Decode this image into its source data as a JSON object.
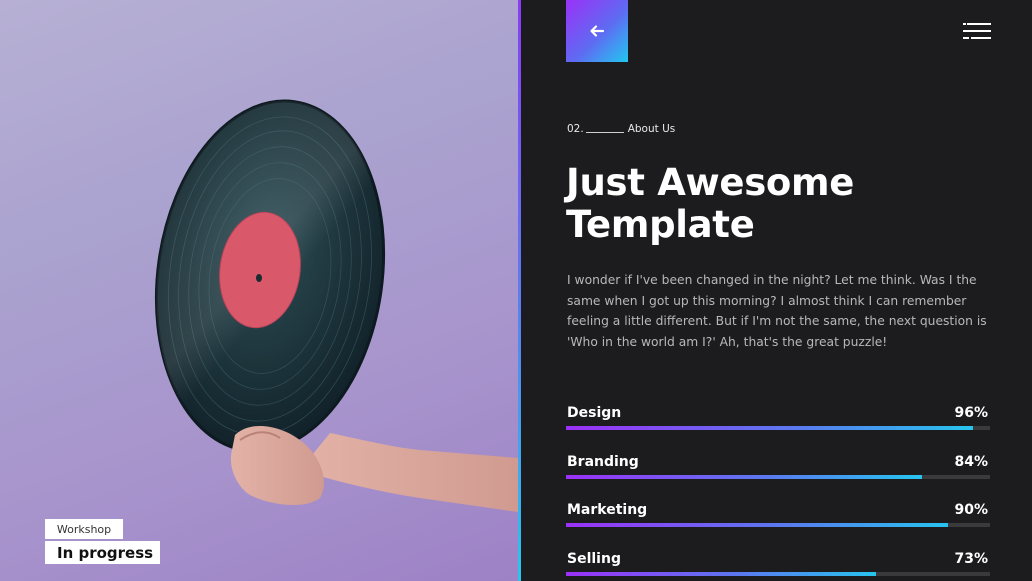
{
  "caption": {
    "tag": "Workshop",
    "title": "In progress"
  },
  "header": {
    "back_icon": "arrow-left-icon",
    "menu_icon": "hamburger-menu-icon"
  },
  "section": {
    "number": "02.",
    "label": "About Us"
  },
  "heading": {
    "line1": "Just Awesome",
    "line2": "Template"
  },
  "description": "I wonder if I've been changed in the night? Let me think. Was I the same when I got up this morning? I almost think I can remember feeling a little different. But if I'm not the same, the next question is 'Who in the world am I?' Ah, that's the great puzzle!",
  "skills": [
    {
      "name": "Design",
      "percent": "96%",
      "value": 96
    },
    {
      "name": "Branding",
      "percent": "84%",
      "value": 84
    },
    {
      "name": "Marketing",
      "percent": "90%",
      "value": 90
    },
    {
      "name": "Selling",
      "percent": "73%",
      "value": 73
    }
  ],
  "colors": {
    "accent_start": "#9b31f7",
    "accent_end": "#27c4ee",
    "panel_bg": "#1c1c1e"
  }
}
